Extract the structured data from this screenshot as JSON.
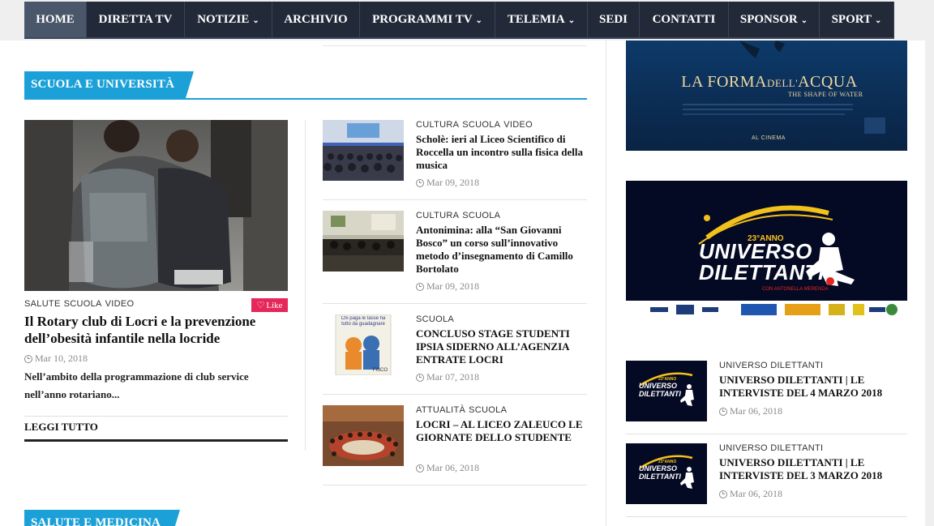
{
  "nav": {
    "items": [
      {
        "label": "HOME",
        "dropdown": false,
        "active": true
      },
      {
        "label": "DIRETTA TV",
        "dropdown": false
      },
      {
        "label": "NOTIZIE",
        "dropdown": true
      },
      {
        "label": "ARCHIVIO",
        "dropdown": false
      },
      {
        "label": "PROGRAMMI TV",
        "dropdown": true
      },
      {
        "label": "TELEMIA",
        "dropdown": true
      },
      {
        "label": "SEDI",
        "dropdown": false
      },
      {
        "label": "CONTATTI",
        "dropdown": false
      },
      {
        "label": "SPONSOR",
        "dropdown": true
      },
      {
        "label": "SPORT",
        "dropdown": true
      }
    ],
    "chevron": "⌄"
  },
  "section_scuola": {
    "title": "SCUOLA E UNIVERSITÀ"
  },
  "section_salute": {
    "title": "SALUTE E MEDICINA"
  },
  "featured": {
    "cats": [
      "SALUTE",
      "SCUOLA",
      "VIDEO"
    ],
    "like_label": "Like",
    "title": "Il Rotary club di Locri e la prevenzione dell’obesità infantile nella locride",
    "date": "Mar 10, 2018",
    "excerpt": "Nell’ambito della programmazione di club service nell’anno rotariano...",
    "readmore": "LEGGI TUTTO"
  },
  "articles": [
    {
      "cats": [
        "CULTURA",
        "SCUOLA",
        "VIDEO"
      ],
      "title": "Scholè: ieri al Liceo Scientifico di Roccella un incontro sulla fisica della musica",
      "date": "Mar 09, 2018"
    },
    {
      "cats": [
        "CULTURA",
        "SCUOLA"
      ],
      "title": "Antonimina: alla “San Giovanni Bosco” un corso sull’innovativo metodo d’insegnamento di Camillo Bortolato",
      "date": "Mar 09, 2018"
    },
    {
      "cats": [
        "SCUOLA"
      ],
      "title": "CONCLUSO STAGE STUDENTI IPSIA SIDERNO ALL’AGENZIA ENTRATE LOCRI",
      "date": "Mar 07, 2018"
    },
    {
      "cats": [
        "ATTUALITÀ",
        "SCUOLA"
      ],
      "title": "LOCRI – AL LICEO ZALEUCO LE GIORNATE DELLO STUDENTE",
      "date": "Mar 06, 2018"
    }
  ],
  "ads": {
    "movie": {
      "title_a": "LA FORMA",
      "title_b": "DELL'",
      "title_c": "ACQUA",
      "subtitle": "THE SHAPE OF WATER",
      "footer": "AL CINEMA"
    },
    "universo": {
      "edition": "23°ANNO",
      "line1": "UNIVERSO",
      "line2": "DILETTANTI",
      "byline": "CON ANTONELLA MERENDA"
    }
  },
  "sidebar": [
    {
      "cats": [
        "UNIVERSO DILETTANTI"
      ],
      "title": "UNIVERSO DILETTANTI | LE INTERVISTE DEL 4 MARZO 2018",
      "date": "Mar 06, 2018"
    },
    {
      "cats": [
        "UNIVERSO DILETTANTI"
      ],
      "title": "UNIVERSO DILETTANTI | LE INTERVISTE DEL 3 MARZO 2018",
      "date": "Mar 06, 2018"
    }
  ],
  "thumbs": {
    "poster_top": "Chi paga le tasse ha tutto da guadagnare",
    "poster_bottom": "FISCO",
    "mini_edition": "23°ANNO",
    "mini_line1": "UNIVERSO",
    "mini_line2": "DILETTANTI"
  },
  "colors": {
    "accent": "#1ba1d8",
    "nav_bg": "#222a3a",
    "like": "#e5275a"
  }
}
